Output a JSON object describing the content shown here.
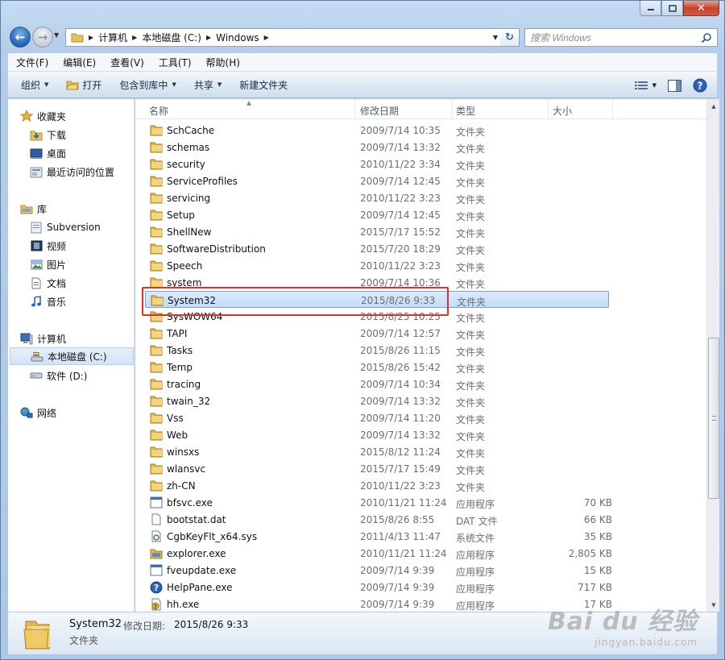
{
  "window": {
    "close_glyph": "✕"
  },
  "address": {
    "crumbs": [
      "计算机",
      "本地磁盘 (C:)",
      "Windows"
    ]
  },
  "search": {
    "placeholder": "搜索 Windows"
  },
  "menu": [
    "文件(F)",
    "编辑(E)",
    "查看(V)",
    "工具(T)",
    "帮助(H)"
  ],
  "commands": {
    "organize": "组织",
    "open": "打开",
    "include": "包含到库中",
    "share": "共享",
    "new_folder": "新建文件夹"
  },
  "nav": {
    "favorites": {
      "label": "收藏夹",
      "items": [
        "下载",
        "桌面",
        "最近访问的位置"
      ]
    },
    "libraries": {
      "label": "库",
      "items": [
        "Subversion",
        "视频",
        "图片",
        "文档",
        "音乐"
      ]
    },
    "computer": {
      "label": "计算机",
      "items": [
        "本地磁盘 (C:)",
        "软件 (D:)"
      ]
    },
    "network": {
      "label": "网络"
    }
  },
  "columns": {
    "name": "名称",
    "date": "修改日期",
    "type": "类型",
    "size": "大小"
  },
  "files": [
    {
      "name": "SchCache",
      "date": "2009/7/14 10:35",
      "type": "文件夹",
      "size": "",
      "icon": "folder"
    },
    {
      "name": "schemas",
      "date": "2009/7/14 13:32",
      "type": "文件夹",
      "size": "",
      "icon": "folder"
    },
    {
      "name": "security",
      "date": "2010/11/22 3:34",
      "type": "文件夹",
      "size": "",
      "icon": "folder"
    },
    {
      "name": "ServiceProfiles",
      "date": "2009/7/14 12:45",
      "type": "文件夹",
      "size": "",
      "icon": "folder"
    },
    {
      "name": "servicing",
      "date": "2010/11/22 3:23",
      "type": "文件夹",
      "size": "",
      "icon": "folder"
    },
    {
      "name": "Setup",
      "date": "2009/7/14 12:45",
      "type": "文件夹",
      "size": "",
      "icon": "folder"
    },
    {
      "name": "ShellNew",
      "date": "2015/7/17 15:52",
      "type": "文件夹",
      "size": "",
      "icon": "folder"
    },
    {
      "name": "SoftwareDistribution",
      "date": "2015/7/20 18:29",
      "type": "文件夹",
      "size": "",
      "icon": "folder"
    },
    {
      "name": "Speech",
      "date": "2010/11/22 3:23",
      "type": "文件夹",
      "size": "",
      "icon": "folder"
    },
    {
      "name": "system",
      "date": "2009/7/14 10:36",
      "type": "文件夹",
      "size": "",
      "icon": "folder"
    },
    {
      "name": "System32",
      "date": "2015/8/26 9:33",
      "type": "文件夹",
      "size": "",
      "icon": "folder",
      "selected": true
    },
    {
      "name": "SysWOW64",
      "date": "2015/8/25 10:25",
      "type": "文件夹",
      "size": "",
      "icon": "folder"
    },
    {
      "name": "TAPI",
      "date": "2009/7/14 12:57",
      "type": "文件夹",
      "size": "",
      "icon": "folder"
    },
    {
      "name": "Tasks",
      "date": "2015/8/26 11:15",
      "type": "文件夹",
      "size": "",
      "icon": "folder"
    },
    {
      "name": "Temp",
      "date": "2015/8/26 15:42",
      "type": "文件夹",
      "size": "",
      "icon": "folder"
    },
    {
      "name": "tracing",
      "date": "2009/7/14 10:34",
      "type": "文件夹",
      "size": "",
      "icon": "folder"
    },
    {
      "name": "twain_32",
      "date": "2009/7/14 13:32",
      "type": "文件夹",
      "size": "",
      "icon": "folder"
    },
    {
      "name": "Vss",
      "date": "2009/7/14 11:20",
      "type": "文件夹",
      "size": "",
      "icon": "folder"
    },
    {
      "name": "Web",
      "date": "2009/7/14 13:32",
      "type": "文件夹",
      "size": "",
      "icon": "folder"
    },
    {
      "name": "winsxs",
      "date": "2015/8/12 11:24",
      "type": "文件夹",
      "size": "",
      "icon": "folder"
    },
    {
      "name": "wlansvc",
      "date": "2015/7/17 15:49",
      "type": "文件夹",
      "size": "",
      "icon": "folder"
    },
    {
      "name": "zh-CN",
      "date": "2010/11/22 3:23",
      "type": "文件夹",
      "size": "",
      "icon": "folder"
    },
    {
      "name": "bfsvc.exe",
      "date": "2010/11/21 11:24",
      "type": "应用程序",
      "size": "70 KB",
      "icon": "exe"
    },
    {
      "name": "bootstat.dat",
      "date": "2015/8/26 8:55",
      "type": "DAT 文件",
      "size": "66 KB",
      "icon": "file"
    },
    {
      "name": "CgbKeyFlt_x64.sys",
      "date": "2011/4/13 11:47",
      "type": "系统文件",
      "size": "35 KB",
      "icon": "sys"
    },
    {
      "name": "explorer.exe",
      "date": "2010/11/21 11:24",
      "type": "应用程序",
      "size": "2,805 KB",
      "icon": "explorer"
    },
    {
      "name": "fveupdate.exe",
      "date": "2009/7/14 9:39",
      "type": "应用程序",
      "size": "15 KB",
      "icon": "exe"
    },
    {
      "name": "HelpPane.exe",
      "date": "2009/7/14 9:39",
      "type": "应用程序",
      "size": "717 KB",
      "icon": "help"
    },
    {
      "name": "hh.exe",
      "date": "2009/7/14 9:39",
      "type": "应用程序",
      "size": "17 KB",
      "icon": "hh"
    }
  ],
  "details": {
    "name": "System32",
    "meta_label": "修改日期:",
    "meta_value": "2015/8/26 9:33",
    "type": "文件夹"
  },
  "watermark": {
    "main": "Bai du 经验",
    "sub": "jingyan.baidu.com"
  }
}
